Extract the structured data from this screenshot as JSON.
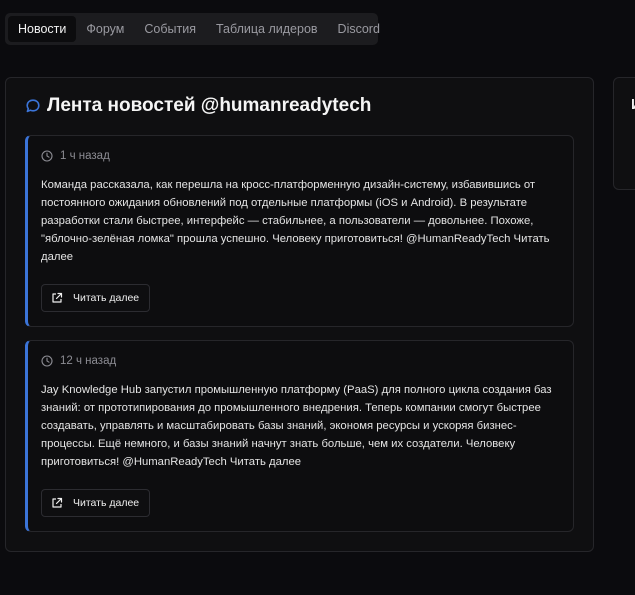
{
  "tabs": [
    {
      "label": "Новости",
      "active": true
    },
    {
      "label": "Форум",
      "active": false
    },
    {
      "label": "События",
      "active": false
    },
    {
      "label": "Таблица лидеров",
      "active": false
    },
    {
      "label": "Discord",
      "active": false
    }
  ],
  "feed": {
    "title": "Лента новостей @humanreadytech",
    "title_icon": "chat-bubble-icon",
    "accent_color": "#3b74d8",
    "posts": [
      {
        "time": "1 ч назад",
        "text": "Команда рассказала, как перешла на кросс-платформенную дизайн-систему, избавившись от постоянного ожидания обновлений под отдельные платформы (iOS и Android). В результате разработки стали быстрее, интерфейс — стабильнее, а пользователи — довольнее. Похоже, \"яблочно-зелёная ломка\" прошла успешно. Человеку приготовиться! @HumanReadyTech Читать далее",
        "button_label": "Читать далее"
      },
      {
        "time": "12 ч назад",
        "text": "Jay Knowledge Hub запустил промышленную платформу (PaaS) для полного цикла создания баз знаний: от прототипирования до промышленного внедрения. Теперь компании смогут быстрее создавать, управлять и масштабировать базы знаний, экономя ресурсы и ускоряя бизнес-процессы. Ещё немного, и базы знаний начнут знать больше, чем их создатели. Человеку приготовиться! @HumanReadyTech Читать далее",
        "button_label": "Читать далее"
      }
    ]
  },
  "side_panel": {
    "title_partial": "И"
  }
}
